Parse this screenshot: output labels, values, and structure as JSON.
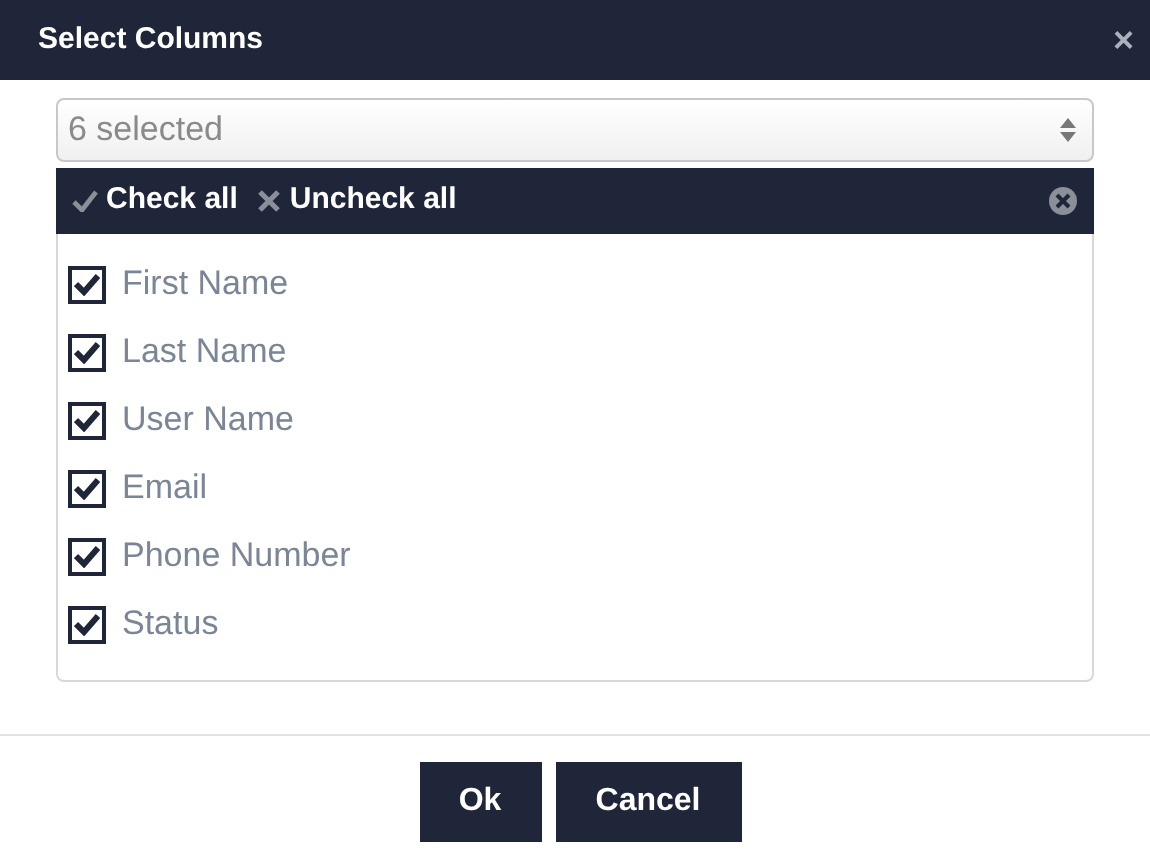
{
  "dialog": {
    "title": "Select Columns",
    "close": "×"
  },
  "select": {
    "value": "6 selected"
  },
  "toolbar": {
    "check_all": "Check all",
    "uncheck_all": "Uncheck all"
  },
  "options": [
    {
      "label": "First Name",
      "checked": true
    },
    {
      "label": "Last Name",
      "checked": true
    },
    {
      "label": "User Name",
      "checked": true
    },
    {
      "label": "Email",
      "checked": true
    },
    {
      "label": "Phone Number",
      "checked": true
    },
    {
      "label": "Status",
      "checked": true
    }
  ],
  "buttons": [
    "Ok",
    "Cancel"
  ]
}
